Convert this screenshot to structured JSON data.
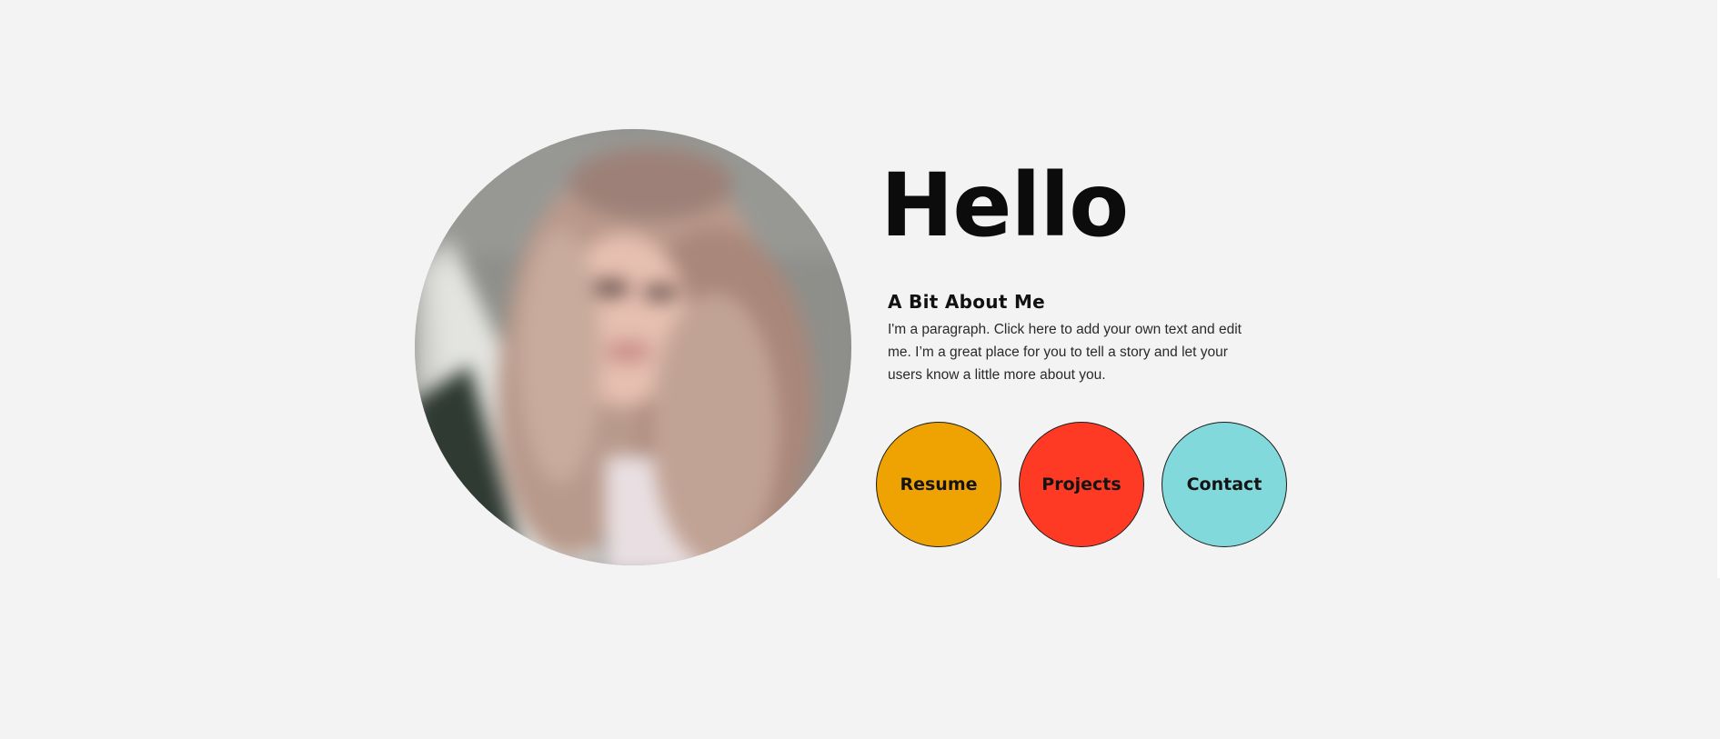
{
  "hero": {
    "title": "Hello"
  },
  "about": {
    "heading": "A Bit About Me",
    "paragraph": "I'm a paragraph. Click here to add your own text and edit me. I’m a great place for you to tell a story and let your users know a little more about you."
  },
  "buttons": [
    {
      "label": "Resume",
      "color": "#eea302"
    },
    {
      "label": "Projects",
      "color": "#ff3a24"
    },
    {
      "label": "Contact",
      "color": "#82d9db"
    }
  ],
  "colors": {
    "background": "#f3f3f3",
    "text": "#0c0c0c"
  }
}
